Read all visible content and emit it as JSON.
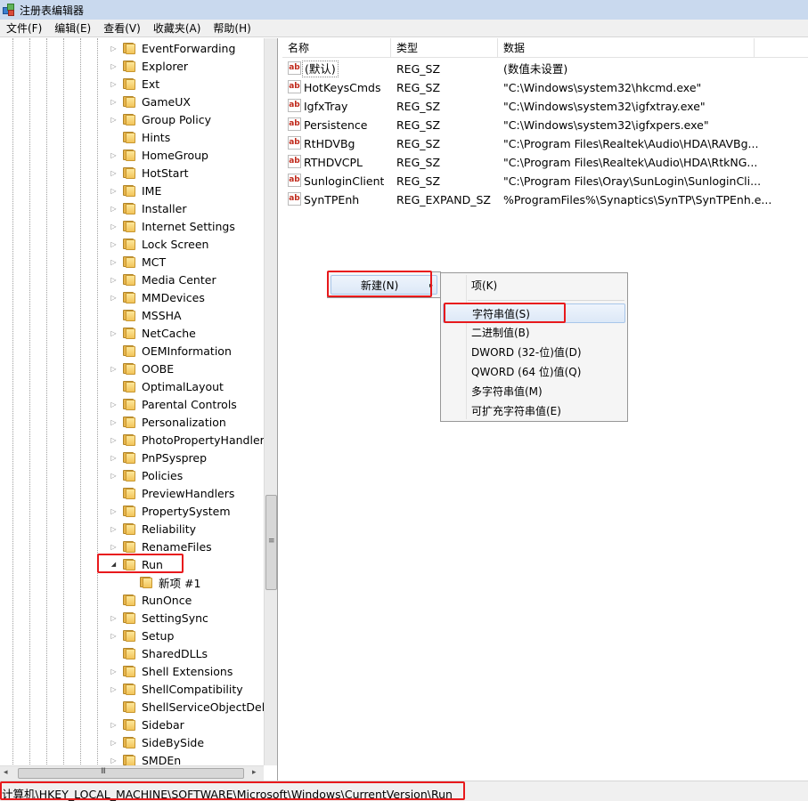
{
  "window": {
    "title": "注册表编辑器"
  },
  "menubar": [
    "文件(F)",
    "编辑(E)",
    "查看(V)",
    "收藏夹(A)",
    "帮助(H)"
  ],
  "tree": {
    "items": [
      {
        "label": "EventForwarding",
        "arrow": "▷"
      },
      {
        "label": "Explorer",
        "arrow": "▷"
      },
      {
        "label": "Ext",
        "arrow": "▷"
      },
      {
        "label": "GameUX",
        "arrow": "▷"
      },
      {
        "label": "Group Policy",
        "arrow": "▷"
      },
      {
        "label": "Hints",
        "arrow": ""
      },
      {
        "label": "HomeGroup",
        "arrow": "▷"
      },
      {
        "label": "HotStart",
        "arrow": "▷"
      },
      {
        "label": "IME",
        "arrow": "▷"
      },
      {
        "label": "Installer",
        "arrow": "▷"
      },
      {
        "label": "Internet Settings",
        "arrow": "▷"
      },
      {
        "label": "Lock Screen",
        "arrow": "▷"
      },
      {
        "label": "MCT",
        "arrow": "▷"
      },
      {
        "label": "Media Center",
        "arrow": "▷"
      },
      {
        "label": "MMDevices",
        "arrow": "▷"
      },
      {
        "label": "MSSHA",
        "arrow": ""
      },
      {
        "label": "NetCache",
        "arrow": "▷"
      },
      {
        "label": "OEMInformation",
        "arrow": ""
      },
      {
        "label": "OOBE",
        "arrow": "▷"
      },
      {
        "label": "OptimalLayout",
        "arrow": ""
      },
      {
        "label": "Parental Controls",
        "arrow": "▷"
      },
      {
        "label": "Personalization",
        "arrow": "▷"
      },
      {
        "label": "PhotoPropertyHandler",
        "arrow": "▷"
      },
      {
        "label": "PnPSysprep",
        "arrow": "▷"
      },
      {
        "label": "Policies",
        "arrow": "▷"
      },
      {
        "label": "PreviewHandlers",
        "arrow": ""
      },
      {
        "label": "PropertySystem",
        "arrow": "▷"
      },
      {
        "label": "Reliability",
        "arrow": "▷"
      },
      {
        "label": "RenameFiles",
        "arrow": "▷"
      },
      {
        "label": "Run",
        "arrow": "◢"
      },
      {
        "label": "新项 #1",
        "arrow": "",
        "child": true
      },
      {
        "label": "RunOnce",
        "arrow": ""
      },
      {
        "label": "SettingSync",
        "arrow": "▷"
      },
      {
        "label": "Setup",
        "arrow": "▷"
      },
      {
        "label": "SharedDLLs",
        "arrow": ""
      },
      {
        "label": "Shell Extensions",
        "arrow": "▷"
      },
      {
        "label": "ShellCompatibility",
        "arrow": "▷"
      },
      {
        "label": "ShellServiceObjectDelay",
        "arrow": ""
      },
      {
        "label": "Sidebar",
        "arrow": "▷"
      },
      {
        "label": "SideBySide",
        "arrow": "▷"
      },
      {
        "label": "SMDEn",
        "arrow": "▷"
      }
    ]
  },
  "scroll": {
    "h_left": "◂",
    "h_right": "▸",
    "h_grip": "III",
    "v_grip": "≡"
  },
  "list": {
    "headers": [
      "名称",
      "类型",
      "数据"
    ],
    "rows": [
      {
        "name": "(默认)",
        "type": "REG_SZ",
        "data": "(数值未设置)",
        "icon": "ab"
      },
      {
        "name": "HotKeysCmds",
        "type": "REG_SZ",
        "data": "\"C:\\Windows\\system32\\hkcmd.exe\"",
        "icon": "ab"
      },
      {
        "name": "IgfxTray",
        "type": "REG_SZ",
        "data": "\"C:\\Windows\\system32\\igfxtray.exe\"",
        "icon": "ab"
      },
      {
        "name": "Persistence",
        "type": "REG_SZ",
        "data": "\"C:\\Windows\\system32\\igfxpers.exe\"",
        "icon": "ab"
      },
      {
        "name": "RtHDVBg",
        "type": "REG_SZ",
        "data": "\"C:\\Program Files\\Realtek\\Audio\\HDA\\RAVBg...",
        "icon": "ab"
      },
      {
        "name": "RTHDVCPL",
        "type": "REG_SZ",
        "data": "\"C:\\Program Files\\Realtek\\Audio\\HDA\\RtkNG...",
        "icon": "ab"
      },
      {
        "name": "SunloginClient",
        "type": "REG_SZ",
        "data": "\"C:\\Program Files\\Oray\\SunLogin\\SunloginCli...",
        "icon": "ab"
      },
      {
        "name": "SynTPEnh",
        "type": "REG_EXPAND_SZ",
        "data": "%ProgramFiles%\\Synaptics\\SynTP\\SynTPEnh.e...",
        "icon": "ab"
      }
    ]
  },
  "context_menu": {
    "label": "新建(N)",
    "arrow": "▸"
  },
  "submenu": {
    "items": [
      "项(K)",
      "字符串值(S)",
      "二进制值(B)",
      "DWORD (32-位)值(D)",
      "QWORD (64 位)值(Q)",
      "多字符串值(M)",
      "可扩充字符串值(E)"
    ]
  },
  "status": {
    "path": "计算机\\HKEY_LOCAL_MACHINE\\SOFTWARE\\Microsoft\\Windows\\CurrentVersion\\Run"
  },
  "colors": {
    "highlight": "#e8191c",
    "menu_hot": "#dce8f7"
  }
}
